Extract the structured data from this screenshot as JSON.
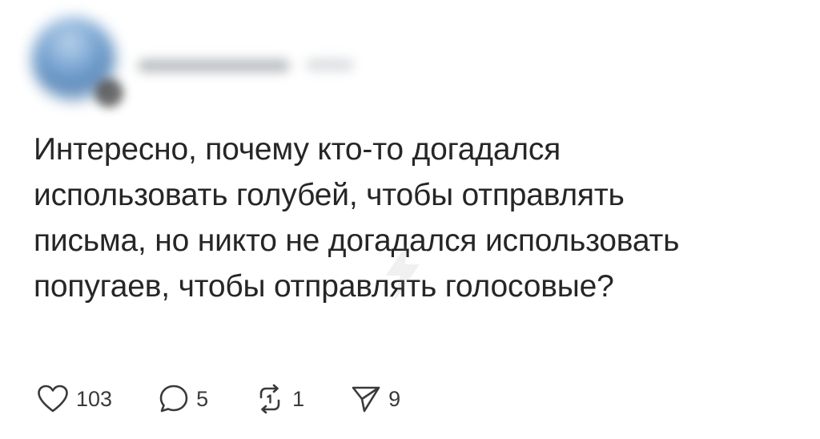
{
  "post": {
    "text": "Интересно, почему кто-то догадался\nиспользовать голубей, чтобы отправлять\nписьма, но никто не догадался использовать\nпопугаев, чтобы отправлять голосовые?"
  },
  "actions": {
    "likes": "103",
    "replies": "5",
    "reposts": "1",
    "shares": "9"
  }
}
